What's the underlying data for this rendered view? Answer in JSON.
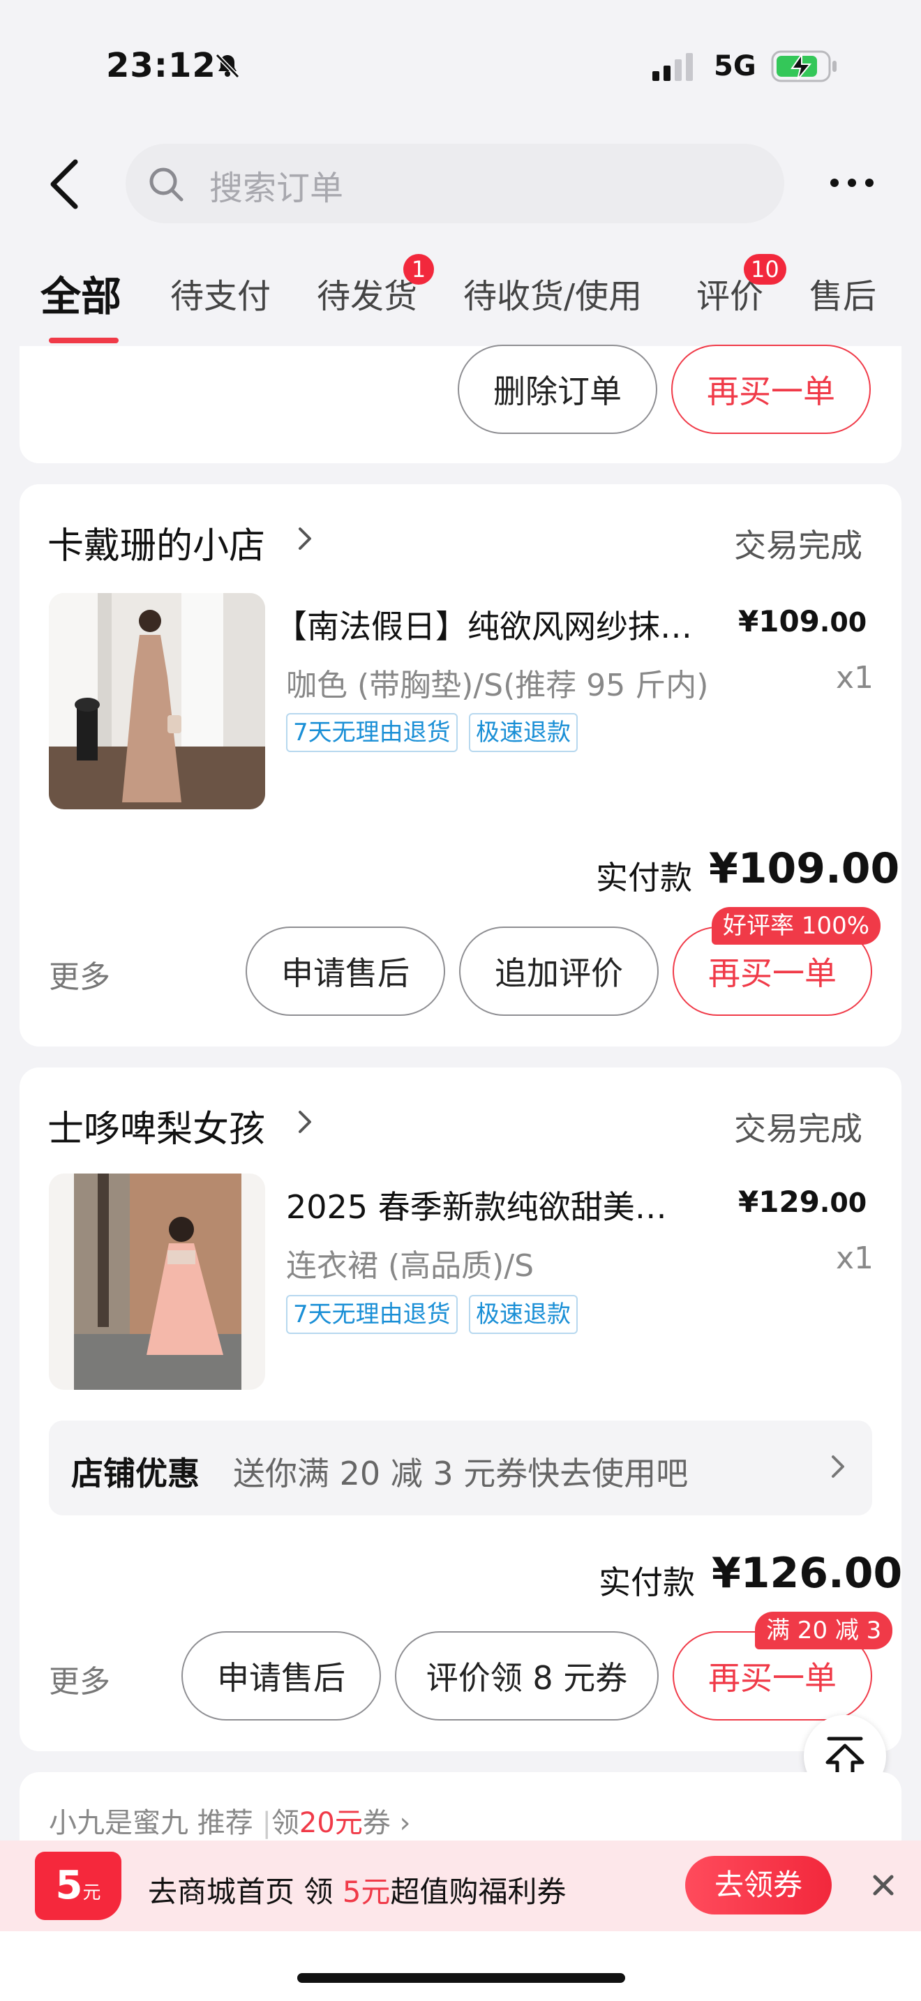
{
  "status_bar": {
    "time": "23:12",
    "network": "5G"
  },
  "search": {
    "placeholder": "搜索订单"
  },
  "tabs": [
    {
      "label": "全部",
      "active": true
    },
    {
      "label": "待支付"
    },
    {
      "label": "待发货",
      "badge": "1"
    },
    {
      "label": "待收货/使用"
    },
    {
      "label": "评价",
      "badge": "10"
    },
    {
      "label": "售后"
    }
  ],
  "top_card": {
    "delete_label": "删除订单",
    "rebuy_label": "再买一单"
  },
  "orders": [
    {
      "shop": "卡戴珊的小店",
      "status": "交易完成",
      "title": "【南法假日】纯欲风网纱抹…",
      "price_int": "¥109",
      "price_dec": ".00",
      "spec": "咖色 (带胸垫)/S(推荐 95 斤内)",
      "qty": "x1",
      "tags": [
        "7天无理由退货",
        "极速退款"
      ],
      "paid_label": "实付款",
      "paid_amount": "¥109.00",
      "more": "更多",
      "btn1": "申请售后",
      "btn2": "追加评价",
      "btn3": "再买一单",
      "corner_tag": "好评率 100%"
    },
    {
      "shop": "士哆啤梨女孩",
      "status": "交易完成",
      "title": "2025 春季新款纯欲甜美…",
      "price_int": "¥129",
      "price_dec": ".00",
      "spec": "连衣裙 (高品质)/S",
      "qty": "x1",
      "tags": [
        "7天无理由退货",
        "极速退款"
      ],
      "coupon_label": "店铺优惠",
      "coupon_text": "送你满 20 减 3 元券快去使用吧",
      "paid_label": "实付款",
      "paid_amount": "¥126.00",
      "more": "更多",
      "btn1": "申请售后",
      "btn2": "评价领 8 元券",
      "btn3": "再买一单",
      "corner_tag": "满 20 减 3"
    }
  ],
  "recommend": {
    "shop": "小九是蜜九",
    "suffix": "推荐",
    "coupon_prefix": "领",
    "coupon_amount": "20元",
    "coupon_suffix": "券"
  },
  "promo": {
    "badge_amount": "5",
    "badge_unit": "元",
    "text_a": "去商城首页 领 ",
    "text_amount": "5元",
    "text_b": "超值购福利券",
    "button": "去领券"
  },
  "colors": {
    "accent": "#f03a48",
    "tag_blue": "#1a8fd6"
  },
  "icons": [
    "bell-slash-icon",
    "signal-icon",
    "battery-icon",
    "back-icon",
    "search-icon",
    "more-icon",
    "chevron-right-icon",
    "scroll-top-icon",
    "close-icon"
  ]
}
